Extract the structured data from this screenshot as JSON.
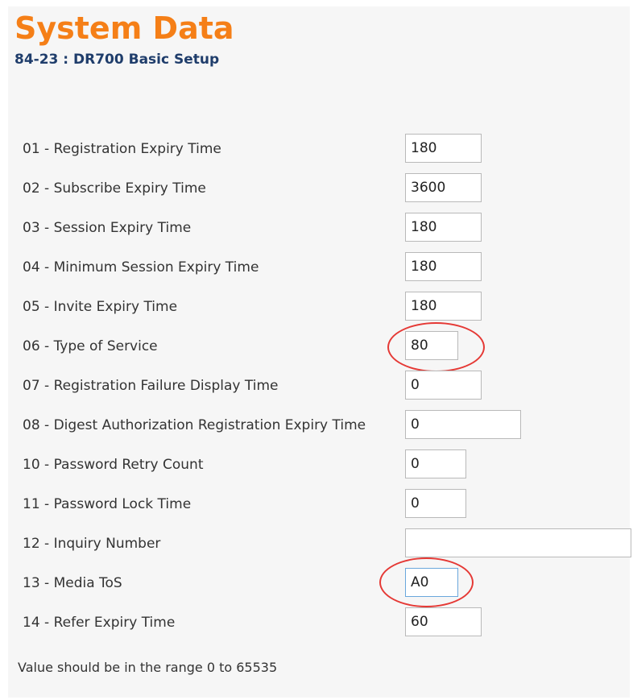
{
  "page": {
    "title": "System Data",
    "subtitle": "84-23 : DR700 Basic Setup",
    "accent_color": "#f57f17",
    "annotation_color": "#e53935"
  },
  "rows": [
    {
      "label": "01 - Registration Expiry Time",
      "value": "180"
    },
    {
      "label": "02 - Subscribe Expiry Time",
      "value": "3600"
    },
    {
      "label": "03 - Session Expiry Time",
      "value": "180"
    },
    {
      "label": "04 - Minimum Session Expiry Time",
      "value": "180"
    },
    {
      "label": "05 - Invite Expiry Time",
      "value": "180"
    },
    {
      "label": "06 - Type of Service",
      "value": "80"
    },
    {
      "label": "07 - Registration Failure Display Time",
      "value": "0"
    },
    {
      "label": "08 - Digest Authorization Registration Expiry Time",
      "value": "0"
    },
    {
      "label": "10 - Password Retry Count",
      "value": "0"
    },
    {
      "label": "11 - Password Lock Time",
      "value": "0"
    },
    {
      "label": "12 - Inquiry Number",
      "value": ""
    },
    {
      "label": "13 - Media ToS",
      "value": "A0"
    },
    {
      "label": "14 - Refer Expiry Time",
      "value": "60"
    }
  ],
  "footer": {
    "range_note": "Value should be in the range 0 to 65535"
  }
}
